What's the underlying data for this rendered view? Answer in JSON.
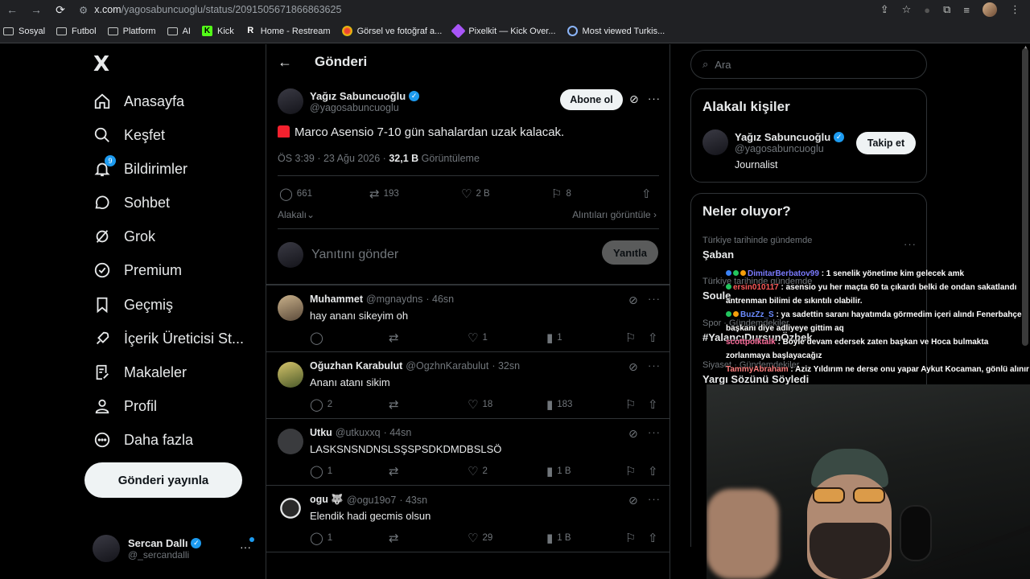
{
  "browser": {
    "url_domain": "x.com",
    "url_path": "/yagosabuncuoglu/status/2091505671866863625",
    "bookmarks": [
      "Sosyal",
      "Futbol",
      "Platform",
      "AI",
      "Kick",
      "Home - Restream",
      "Görsel ve fotoğraf a...",
      "Pixelkit — Kick Over...",
      "Most viewed Turkis..."
    ]
  },
  "sidebar": {
    "logo": "X",
    "items": [
      {
        "label": "Anasayfa",
        "icon": "home-icon"
      },
      {
        "label": "Keşfet",
        "icon": "search-icon"
      },
      {
        "label": "Bildirimler",
        "icon": "bell-icon",
        "badge": "9"
      },
      {
        "label": "Sohbet",
        "icon": "chat-icon"
      },
      {
        "label": "Grok",
        "icon": "grok-icon"
      },
      {
        "label": "Premium",
        "icon": "premium-icon"
      },
      {
        "label": "Geçmiş",
        "icon": "bookmark-icon"
      },
      {
        "label": "İçerik Üreticisi St...",
        "icon": "rocket-icon"
      },
      {
        "label": "Makaleler",
        "icon": "article-icon"
      },
      {
        "label": "Profil",
        "icon": "person-icon"
      },
      {
        "label": "Daha fazla",
        "icon": "more-circle-icon"
      }
    ],
    "post_button": "Gönderi yayınla",
    "account": {
      "name": "Sercan Dallı",
      "handle": "@_sercandalli",
      "more": "···"
    }
  },
  "main": {
    "title": "Gönderi",
    "tweet": {
      "author_name": "Yağız Sabuncuoğlu",
      "author_handle": "@yagosabuncuoglu",
      "follow_label": "Abone ol",
      "text": "Marco Asensio 7-10 gün sahalardan uzak kalacak.",
      "timestamp": "ÖS 3:39 · 23 Ağu 2026 ·",
      "views": "32,1 B",
      "views_label": "Görüntüleme",
      "replies": "661",
      "reposts": "193",
      "likes": "2 B",
      "bookmarks": "8",
      "sort_label": "Alakalı",
      "quotes_label": "Alıntıları görüntüle"
    },
    "reply_box": {
      "placeholder": "Yanıtını gönder",
      "button": "Yanıtla"
    },
    "replies": [
      {
        "name": "Muhammet",
        "handle": "@mgnaydns",
        "time": "· 46sn",
        "text": "hay ananı sikeyim oh",
        "replies": "",
        "reposts": "",
        "likes": "1",
        "views": "1"
      },
      {
        "name": "Oğuzhan Karabulut",
        "handle": "@OgzhnKarabulut",
        "time": "· 32sn",
        "text": "Ananı atanı sikim",
        "replies": "2",
        "reposts": "",
        "likes": "18",
        "views": "183"
      },
      {
        "name": "Utku",
        "handle": "@utkuxxq",
        "time": "· 44sn",
        "text": "LASKSNSNDNSLSŞSPSDKDMDBSLSÖ",
        "replies": "1",
        "reposts": "",
        "likes": "2",
        "views": "1 B"
      },
      {
        "name": "ogu 🐺",
        "handle": "@ogu19o7",
        "time": "· 43sn",
        "text": "Elendik hadi gecmis olsun",
        "replies": "1",
        "reposts": "",
        "likes": "29",
        "views": "1 B"
      }
    ]
  },
  "right": {
    "search_placeholder": "Ara",
    "people_title": "Alakalı kişiler",
    "person": {
      "name": "Yağız Sabuncuoğlu",
      "handle": "@yagosabuncuoglu",
      "bio": "Journalist",
      "button": "Takip et"
    },
    "trends_title": "Neler oluyor?",
    "trends": [
      {
        "meta": "Türkiye tarihinde gündemde",
        "topic": "Şaban"
      },
      {
        "meta": "Türkiye tarihinde gündemde",
        "topic": "Soule"
      },
      {
        "meta": "Spor · Gündemdekiler",
        "topic": "#YalancıDursunÖzbek"
      },
      {
        "meta": "Siyaset · Gündemdekiler",
        "topic": "Yargı Sözünü Söyledi"
      }
    ]
  },
  "chat": [
    {
      "user": "DimitarBerbatov99",
      "msg": ": 1 senelik yönetime kim gelecek amk"
    },
    {
      "user": "ersin010117",
      "msg": ": asensio yu her maçta 60 ta çıkardı belki de ondan sakatlandı antrenman bilimi de sıkıntılı olabilir."
    },
    {
      "user": "BuzZz_S",
      "msg": ": ya sadettin saranı hayatımda görmedim içeri alındı Fenerbahçe başkanı diye adliyeye gittim aq"
    },
    {
      "user": "scottpolktalk",
      "msg": ": Böyle devam edersek zaten başkan ve Hoca bulmakta zorlanmaya başlayacağız"
    },
    {
      "user": "TammyAbraham",
      "msg": ": Aziz Yıldırım ne derse onu yapar Aykut Kocaman, gönlü alınır"
    }
  ]
}
